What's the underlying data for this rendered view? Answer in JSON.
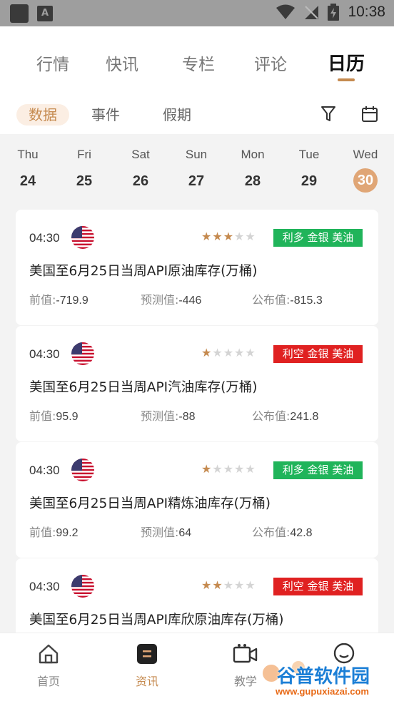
{
  "status_bar": {
    "time": "10:38"
  },
  "top_tabs": [
    "行情",
    "快讯",
    "专栏",
    "评论",
    "日历"
  ],
  "active_top_tab": "日历",
  "sub_tabs": [
    "数据",
    "事件",
    "假期"
  ],
  "active_sub_tab": "数据",
  "week": [
    {
      "name": "Thu",
      "num": "24"
    },
    {
      "name": "Fri",
      "num": "25"
    },
    {
      "name": "Sat",
      "num": "26"
    },
    {
      "name": "Sun",
      "num": "27"
    },
    {
      "name": "Mon",
      "num": "28"
    },
    {
      "name": "Tue",
      "num": "29"
    },
    {
      "name": "Wed",
      "num": "30"
    }
  ],
  "selected_day": "30",
  "events": [
    {
      "time": "04:30",
      "flag": "us-flag-icon",
      "stars": 3,
      "max_stars": 5,
      "badge": "利多 金银 美油",
      "badge_color": "#20b45a",
      "title": "美国至6月25日当周API原油库存(万桶)",
      "prev_label": "前值:",
      "prev": "-719.9",
      "forecast_label": "预测值:",
      "forecast": "-446",
      "actual_label": "公布值:",
      "actual": "-815.3"
    },
    {
      "time": "04:30",
      "flag": "us-flag-icon",
      "stars": 1,
      "max_stars": 5,
      "badge": "利空 金银 美油",
      "badge_color": "#e02121",
      "title": "美国至6月25日当周API汽油库存(万桶)",
      "prev_label": "前值:",
      "prev": "95.9",
      "forecast_label": "预测值:",
      "forecast": "-88",
      "actual_label": "公布值:",
      "actual": "241.8"
    },
    {
      "time": "04:30",
      "flag": "us-flag-icon",
      "stars": 1,
      "max_stars": 5,
      "badge": "利多 金银 美油",
      "badge_color": "#20b45a",
      "title": "美国至6月25日当周API精炼油库存(万桶)",
      "prev_label": "前值:",
      "prev": "99.2",
      "forecast_label": "预测值:",
      "forecast": "64",
      "actual_label": "公布值:",
      "actual": "42.8"
    },
    {
      "time": "04:30",
      "flag": "us-flag-icon",
      "stars": 2,
      "max_stars": 5,
      "badge": "利空 金银 美油",
      "badge_color": "#e02121",
      "title": "美国至6月25日当周API库欣原油库存(万桶)",
      "prev_label": "",
      "prev": "",
      "forecast_label": "",
      "forecast": "",
      "actual_label": "",
      "actual": ""
    }
  ],
  "bottom_nav": [
    {
      "label": "首页",
      "icon": "home-icon"
    },
    {
      "label": "资讯",
      "icon": "news-icon"
    },
    {
      "label": "教学",
      "icon": "video-icon"
    },
    {
      "label": "",
      "icon": "chat-icon"
    }
  ],
  "active_bottom_nav": "资讯",
  "watermark": {
    "text": "谷普软件园",
    "url": "www.gupuxiazai.com"
  },
  "colors": {
    "accent": "#c58a4f",
    "bullish": "#20b45a",
    "bearish": "#e02121"
  }
}
